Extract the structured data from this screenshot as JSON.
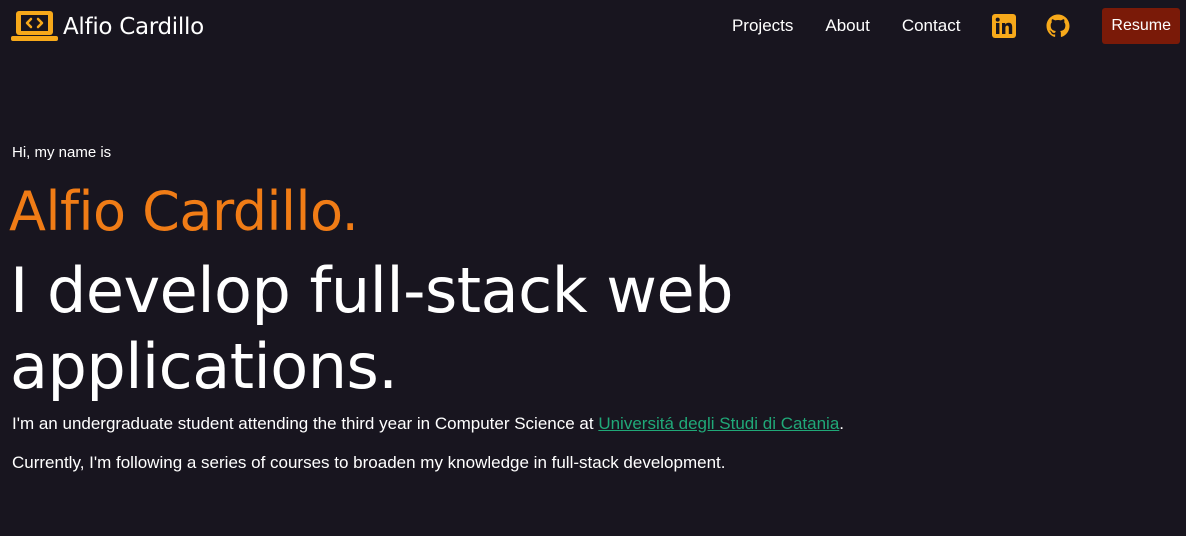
{
  "header": {
    "brand_name": "Alfio Cardillo",
    "nav": {
      "projects": "Projects",
      "about": "About",
      "contact": "Contact"
    },
    "social_icons": [
      "linkedin-icon",
      "github-icon"
    ],
    "resume_label": "Resume"
  },
  "hero": {
    "greeting": "Hi, my name is",
    "name": "Alfio Cardillo.",
    "tagline": "I develop full-stack web applications.",
    "intro_before_link": "I'm an undergraduate student attending the third year in Computer Science at ",
    "university_link": "Universitá degli Studi di Catania",
    "intro_after_link": ".",
    "currently": "Currently, I'm following a series of courses to broaden my knowledge in full-stack development."
  },
  "colors": {
    "background": "#18151f",
    "accent_orange": "#f07c16",
    "icon_orange": "#f7a91a",
    "link_green": "#20a878",
    "resume_button": "#7a1a08"
  }
}
